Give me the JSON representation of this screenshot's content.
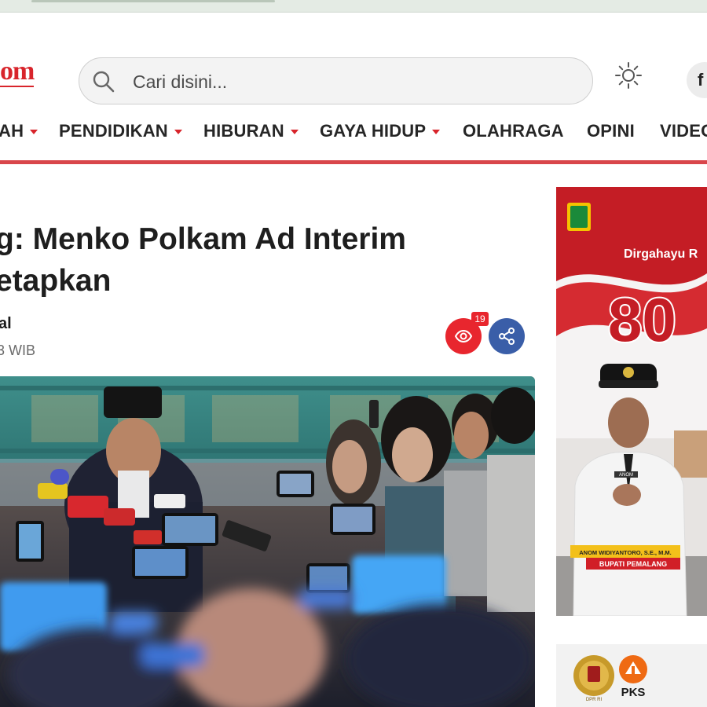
{
  "header": {
    "logo_text": "om",
    "search_placeholder": "Cari disini...",
    "theme_icon": "sun-icon",
    "social_label": "f"
  },
  "nav": {
    "items": [
      {
        "label": "AH",
        "has_dropdown": true
      },
      {
        "label": "PENDIDIKAN",
        "has_dropdown": true
      },
      {
        "label": "HIBURAN",
        "has_dropdown": true
      },
      {
        "label": "GAYA HIDUP",
        "has_dropdown": true
      },
      {
        "label": "OLAHRAGA",
        "has_dropdown": false
      },
      {
        "label": "OPINI",
        "has_dropdown": false
      },
      {
        "label": "VIDEO",
        "has_dropdown": false
      }
    ]
  },
  "article": {
    "title": "g: Menko Polkam Ad Interim etapkan",
    "author": "al",
    "datetime": "3 WIB",
    "view_count": "19"
  },
  "ads": {
    "ad1": {
      "headline": "Dirgahayu R",
      "number": "80",
      "person_name": "ANOM WIDIYANTORO, S.E., M.M.",
      "person_title": "BUPATI PEMALANG",
      "name_tag": "ANOM"
    },
    "ad2": {
      "party": "PKS",
      "emblem_label": "DPR RI"
    }
  },
  "colors": {
    "brand_red": "#d8242b",
    "nav_rule": "#d9464b",
    "share_blue": "#3a5ea8",
    "view_red": "#e8262e"
  }
}
